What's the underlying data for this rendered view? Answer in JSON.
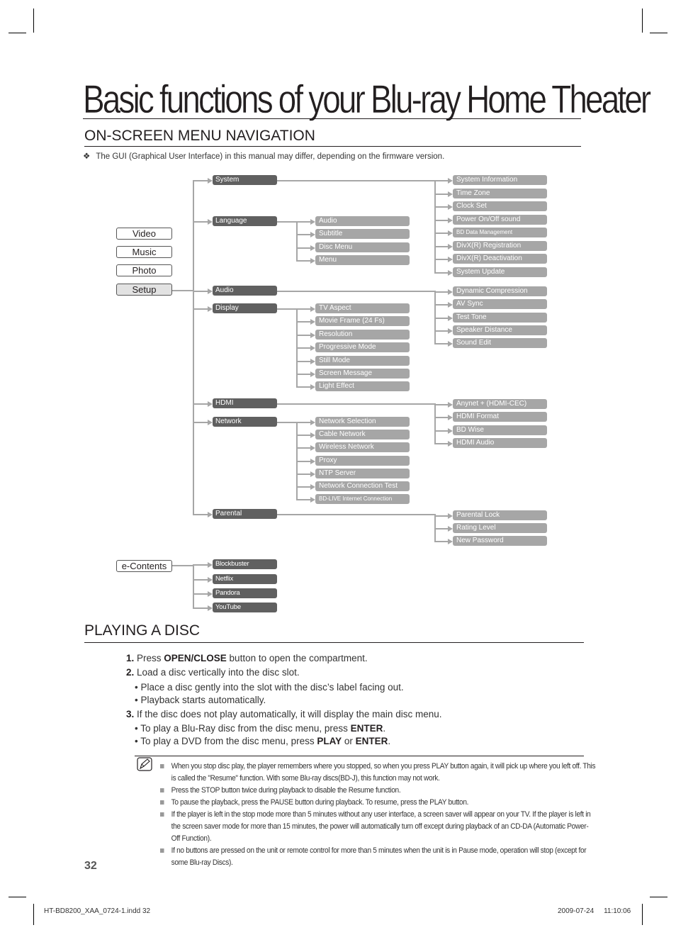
{
  "page": {
    "main_title": "Basic functions of your Blu-ray Home Theater",
    "page_number": "32"
  },
  "menu_section": {
    "title": "ON-SCREEN MENU NAVIGATION",
    "note_bullet": "❖",
    "note": "The GUI (Graphical User Interface) in this manual may differ, depending on the firmware version.",
    "main_menu": [
      {
        "label": "Video",
        "selected": false
      },
      {
        "label": "Music",
        "selected": false
      },
      {
        "label": "Photo",
        "selected": false
      },
      {
        "label": "Setup",
        "selected": true
      }
    ],
    "setup_menu": [
      {
        "label": "System",
        "children": [
          "System Information",
          "Time Zone",
          "Clock Set",
          "Power On/Off sound",
          "BD Data Management",
          "DivX(R) Registration",
          "DivX(R) Deactivation",
          "System Update"
        ]
      },
      {
        "label": "Language",
        "children": [
          "Audio",
          "Subtitle",
          "Disc Menu",
          "Menu"
        ]
      },
      {
        "label": "Audio",
        "children": [
          "Dynamic Compression",
          "AV Sync",
          "Test Tone",
          "Speaker Distance",
          "Sound Edit"
        ]
      },
      {
        "label": "Display",
        "children": [
          "TV Aspect",
          "Movie Frame (24 Fs)",
          "Resolution",
          "Progressive Mode",
          "Still Mode",
          "Screen Message",
          "Light Effect"
        ]
      },
      {
        "label": "HDMI",
        "children": [
          "Anynet + (HDMI-CEC)",
          "HDMI Format",
          "BD Wise",
          "HDMI Audio"
        ]
      },
      {
        "label": "Network",
        "children": [
          "Network Selection",
          "Cable Network",
          "Wireless Network",
          "Proxy",
          "NTP Server",
          "Network Connection Test",
          "BD-LIVE Internet Connection"
        ]
      },
      {
        "label": "Parental",
        "children": [
          "Parental Lock",
          "Rating Level",
          "New Password"
        ]
      }
    ],
    "econtents": {
      "label": "e-Contents",
      "children": [
        "Blockbuster",
        "Netflix",
        "Pandora",
        "YouTube"
      ]
    }
  },
  "disc_section": {
    "title": "PLAYING A DISC",
    "steps": [
      {
        "num": "1.",
        "pre": " Press ",
        "bold": "OPEN/CLOSE",
        "post": " button to open the compartment."
      },
      {
        "num": "2.",
        "pre": " Load a disc vertically into the disc slot.",
        "bold": "",
        "post": ""
      }
    ],
    "step2_bullets": [
      "• Place a disc gently into the slot with the disc’s label facing out.",
      "• Playback starts automatically."
    ],
    "step3": {
      "num": "3.",
      "text": " If the disc does not play automatically, it will display the main disc menu."
    },
    "step3_bullets": [
      {
        "pre": "• To play a Blu-Ray disc from the disc menu, press ",
        "b1": "ENTER",
        "mid": ".",
        "b2": "",
        "post": ""
      },
      {
        "pre": "• To play a DVD from the disc menu, press ",
        "b1": "PLAY",
        "mid": " or ",
        "b2": "ENTER",
        "post": "."
      }
    ],
    "notes": [
      "When you stop disc play, the player remembers where you stopped, so when you press PLAY button again, it will pick up where you left off. This is called the \"Resume\" function. With some Blu-ray discs(BD-J), this function may not work.",
      "Press the STOP button twice during playback to disable the Resume function.",
      "To pause the playback, press the PAUSE button during playback. To resume, press the PLAY button.",
      "If the player is left in the stop mode more than 5 minutes without any user interface, a screen saver will appear on your TV. If the player is left in the screen saver mode for more than 15 minutes, the power will automatically turn off except during playback of an CD-DA (Automatic Power-Off Function).",
      "If no buttons are pressed on the unit or remote control for more than 5 minutes when the unit is in Pause mode, operation will stop (except for some Blu-ray Discs)."
    ]
  },
  "footer": {
    "file": "HT-BD8200_XAA_0724-1.indd   32",
    "date": "2009-07-24",
    "time": "11:10:06"
  }
}
